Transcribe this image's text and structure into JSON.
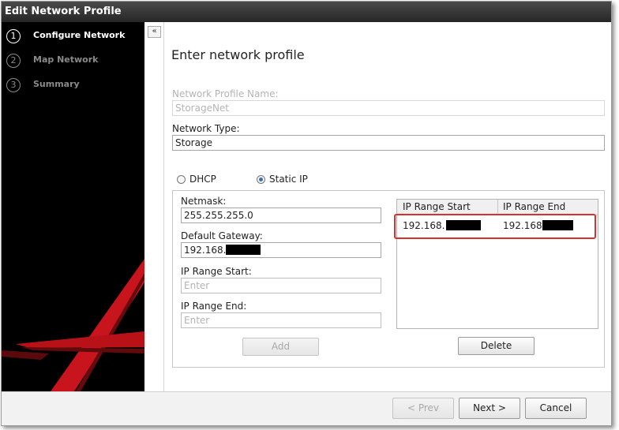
{
  "window": {
    "title": "Edit Network Profile"
  },
  "sidebar": {
    "steps": [
      {
        "num": "1",
        "label": "Configure Network"
      },
      {
        "num": "2",
        "label": "Map Network"
      },
      {
        "num": "3",
        "label": "Summary"
      }
    ],
    "active_step": 1
  },
  "collapse_button": {
    "label": "«"
  },
  "main": {
    "heading": "Enter network profile",
    "profile_name": {
      "label": "Network Profile Name:",
      "value": "StorageNet"
    },
    "network_type": {
      "label": "Network Type:",
      "value": "Storage"
    },
    "addressing": {
      "options": [
        "DHCP",
        "Static IP"
      ],
      "selected": "Static IP"
    },
    "netmask": {
      "label": "Netmask:",
      "value": "255.255.255.0"
    },
    "gateway": {
      "label": "Default Gateway:",
      "value": "192.168."
    },
    "ip_range_start": {
      "label": "IP Range Start:",
      "placeholder": "Enter"
    },
    "ip_range_end": {
      "label": "IP Range End:",
      "placeholder": "Enter"
    },
    "add_button": "Add",
    "delete_button": "Delete",
    "ranges_table": {
      "columns": [
        "IP Range Start",
        "IP Range End"
      ],
      "rows": [
        {
          "start": "192.168.",
          "end": "192.168"
        }
      ]
    }
  },
  "footer": {
    "prev": "< Prev",
    "next": "Next >",
    "cancel": "Cancel"
  },
  "colors": {
    "title_bar": "#2f2f2f",
    "sidebar": "#000000",
    "accent_red": "#d9302c",
    "radio_selected": "#3b6fb0"
  }
}
